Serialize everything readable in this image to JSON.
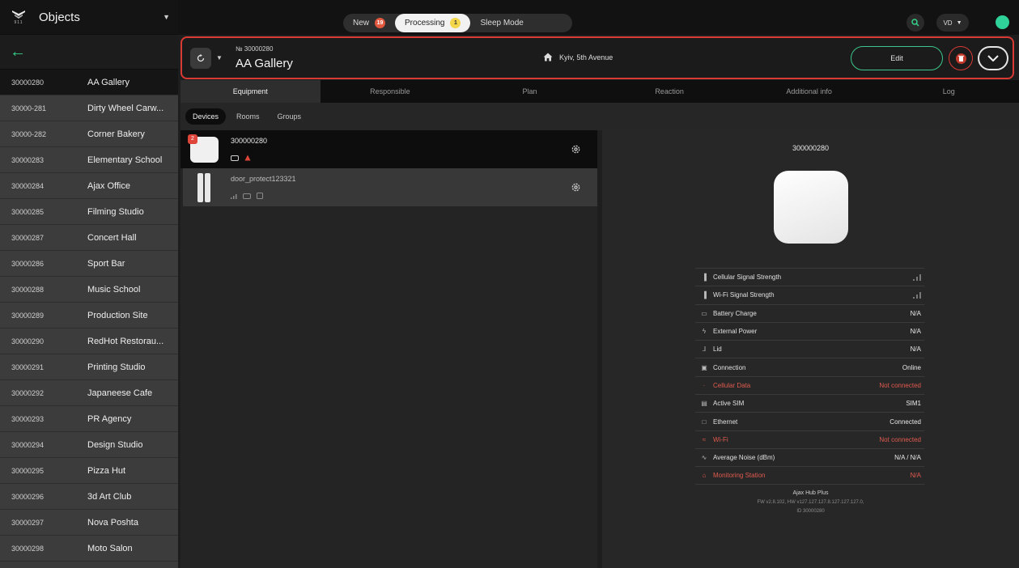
{
  "sidebar": {
    "logo_text": "911",
    "title": "Objects",
    "items": [
      {
        "id": "30000280",
        "name": "AA Gallery"
      },
      {
        "id": "30000-281",
        "name": "Dirty Wheel Carw..."
      },
      {
        "id": "30000-282",
        "name": "Corner Bakery"
      },
      {
        "id": "30000283",
        "name": "Elementary School"
      },
      {
        "id": "30000284",
        "name": "Ajax Office"
      },
      {
        "id": "30000285",
        "name": "Filming Studio"
      },
      {
        "id": "30000287",
        "name": "Concert Hall"
      },
      {
        "id": "30000286",
        "name": "Sport Bar"
      },
      {
        "id": "30000288",
        "name": "Music School"
      },
      {
        "id": "30000289",
        "name": "Production Site"
      },
      {
        "id": "30000290",
        "name": "RedHot Restorau..."
      },
      {
        "id": "30000291",
        "name": "Printing Studio"
      },
      {
        "id": "30000292",
        "name": "Japaneese Cafe"
      },
      {
        "id": "30000293",
        "name": "PR Agency"
      },
      {
        "id": "30000294",
        "name": "Design Studio"
      },
      {
        "id": "30000295",
        "name": "Pizza Hut"
      },
      {
        "id": "30000296",
        "name": "3d Art Club"
      },
      {
        "id": "30000297",
        "name": "Nova Poshta"
      },
      {
        "id": "30000298",
        "name": "Moto Salon"
      }
    ]
  },
  "topbar": {
    "new_label": "New",
    "new_count": "19",
    "processing_label": "Processing",
    "processing_count": "1",
    "sleep_label": "Sleep Mode",
    "user_initials": "VD"
  },
  "object": {
    "number": "№ 30000280",
    "title": "AA Gallery",
    "address": "Kyiv, 5th Avenue",
    "edit_label": "Edit"
  },
  "tabs": [
    "Equipment",
    "Responsible",
    "Plan",
    "Reaction",
    "Additional info",
    "Log"
  ],
  "subtabs": [
    "Devices",
    "Rooms",
    "Groups"
  ],
  "devices": [
    {
      "name": "300000280",
      "count": "2"
    },
    {
      "name": "door_protect123321"
    }
  ],
  "detail": {
    "title": "300000280",
    "properties": [
      {
        "label": "Cellular Signal Strength",
        "value": ""
      },
      {
        "label": "Wi-Fi Signal Strength",
        "value": ""
      },
      {
        "label": "Battery Charge",
        "value": "N/A"
      },
      {
        "label": "External Power",
        "value": "N/A"
      },
      {
        "label": "Lid",
        "value": "N/A"
      },
      {
        "label": "Connection",
        "value": "Online"
      },
      {
        "label": "Cellular Data",
        "value": "Not connected"
      },
      {
        "label": "Active SIM",
        "value": "SIM1"
      },
      {
        "label": "Ethernet",
        "value": "Connected"
      },
      {
        "label": "Wi-Fi",
        "value": "Not connected"
      },
      {
        "label": "Average Noise (dBm)",
        "value": "N/A / N/A"
      },
      {
        "label": "Monitoring Station",
        "value": "N/A"
      }
    ],
    "hub_model": "Ajax Hub Plus",
    "hub_fw": "FW v2.8.102, HW v127.127.127.8.127.127.127.0,",
    "hub_id": "ID 30000280"
  },
  "colors": {
    "accent_green": "#36d18a",
    "alert_red": "#e05a4e",
    "highlight_border": "#d93a33"
  }
}
